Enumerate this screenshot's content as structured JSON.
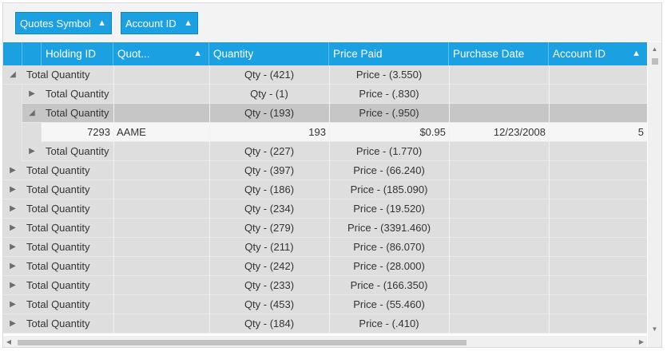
{
  "group_panel": {
    "chips": [
      {
        "label": "Quotes Symbol",
        "sort_icon": "sort-ascending-icon"
      },
      {
        "label": "Account ID",
        "sort_icon": "sort-ascending-icon"
      }
    ]
  },
  "columns": [
    {
      "label": "Holding ID"
    },
    {
      "label": "Quot..."
    },
    {
      "label": "Quantity"
    },
    {
      "label": "Price Paid"
    },
    {
      "label": "Purchase Date"
    },
    {
      "label": "Account ID"
    }
  ],
  "rows": [
    {
      "type": "caption",
      "level": 0,
      "expanded": true,
      "label": "Total Quantity",
      "qty": "Qty - (421)",
      "price": "Price - (3.550)"
    },
    {
      "type": "caption",
      "level": 1,
      "expanded": false,
      "label": "Total Quantity",
      "qty": "Qty - (1)",
      "price": "Price - (.830)"
    },
    {
      "type": "caption",
      "level": 1,
      "expanded": true,
      "selected": true,
      "label": "Total Quantity",
      "qty": "Qty - (193)",
      "price": "Price - (.950)"
    },
    {
      "type": "data",
      "holding_id": "7293",
      "symbol": "AAME",
      "quantity": "193",
      "price_paid": "$0.95",
      "purchase_date": "12/23/2008",
      "account_id": "5"
    },
    {
      "type": "caption",
      "level": 1,
      "expanded": false,
      "label": "Total Quantity",
      "qty": "Qty - (227)",
      "price": "Price - (1.770)"
    },
    {
      "type": "caption",
      "level": 0,
      "expanded": false,
      "label": "Total Quantity",
      "qty": "Qty - (397)",
      "price": "Price - (66.240)"
    },
    {
      "type": "caption",
      "level": 0,
      "expanded": false,
      "label": "Total Quantity",
      "qty": "Qty - (186)",
      "price": "Price - (185.090)"
    },
    {
      "type": "caption",
      "level": 0,
      "expanded": false,
      "label": "Total Quantity",
      "qty": "Qty - (234)",
      "price": "Price - (19.520)"
    },
    {
      "type": "caption",
      "level": 0,
      "expanded": false,
      "label": "Total Quantity",
      "qty": "Qty - (279)",
      "price": "Price - (3391.460)"
    },
    {
      "type": "caption",
      "level": 0,
      "expanded": false,
      "label": "Total Quantity",
      "qty": "Qty - (211)",
      "price": "Price - (86.070)"
    },
    {
      "type": "caption",
      "level": 0,
      "expanded": false,
      "label": "Total Quantity",
      "qty": "Qty - (242)",
      "price": "Price - (28.000)"
    },
    {
      "type": "caption",
      "level": 0,
      "expanded": false,
      "label": "Total Quantity",
      "qty": "Qty - (233)",
      "price": "Price - (166.350)"
    },
    {
      "type": "caption",
      "level": 0,
      "expanded": false,
      "label": "Total Quantity",
      "qty": "Qty - (453)",
      "price": "Price - (55.460)"
    },
    {
      "type": "caption",
      "level": 0,
      "expanded": false,
      "label": "Total Quantity",
      "qty": "Qty - (184)",
      "price": "Price - (.410)"
    }
  ],
  "colors": {
    "accent": "#1ba1e2",
    "caption_row": "#dedede",
    "selected_row": "#c6c6c6",
    "data_row": "#f6f6f6"
  }
}
